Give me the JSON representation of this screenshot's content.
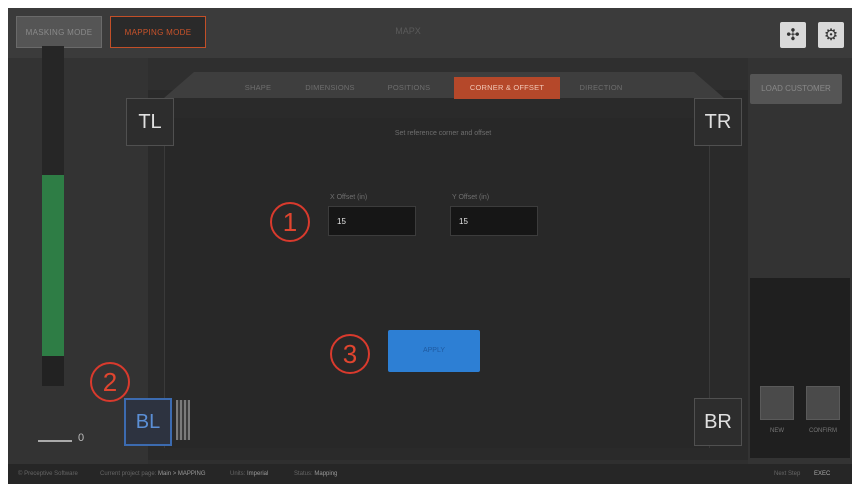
{
  "header": {
    "tabs": [
      {
        "label": "MASKING MODE",
        "active": false
      },
      {
        "label": "MAPPING MODE",
        "active": true
      }
    ],
    "title": "MAPX",
    "icons": [
      "fullscreen-icon",
      "gear-icon"
    ]
  },
  "stage": {
    "tabs": [
      {
        "label": "SHAPE",
        "active": false
      },
      {
        "label": "DIMENSIONS",
        "active": false
      },
      {
        "label": "POSITIONS",
        "active": false
      },
      {
        "label": "CORNER & OFFSET",
        "active": true
      },
      {
        "label": "DIRECTION",
        "active": false
      }
    ],
    "subtitle": "Set reference corner and offset",
    "corners": {
      "tl": "TL",
      "tr": "TR",
      "bl": "BL",
      "br": "BR",
      "selected": "BL"
    },
    "offset_x": {
      "label": "X Offset (in)",
      "value": "15"
    },
    "offset_y": {
      "label": "Y Offset (in)",
      "value": "15"
    },
    "apply_label": "APPLY"
  },
  "annotations": [
    "1",
    "2",
    "3"
  ],
  "left_panel": {
    "meter_value": "0",
    "meter_level": 0.62
  },
  "right_panel": {
    "button_label": "LOAD CUSTOMER",
    "buttons": [
      {
        "label": "NEW"
      },
      {
        "label": "CONFIRM"
      }
    ]
  },
  "statusbar": {
    "left_text": "© Preceptive Software",
    "items": [
      {
        "label": "Current project page:",
        "value": "Main > MAPPING"
      },
      {
        "label": "Units:",
        "value": "Imperial"
      },
      {
        "label": "Status:",
        "value": "Mapping"
      }
    ],
    "right_label": "Next Step",
    "right_value": "EXEC"
  },
  "colors": {
    "accent": "#c24f28",
    "apply": "#2d7fd4",
    "meter": "#2e7d45",
    "annotation": "#d93a2d",
    "selected_corner": "#3c6bb0"
  }
}
